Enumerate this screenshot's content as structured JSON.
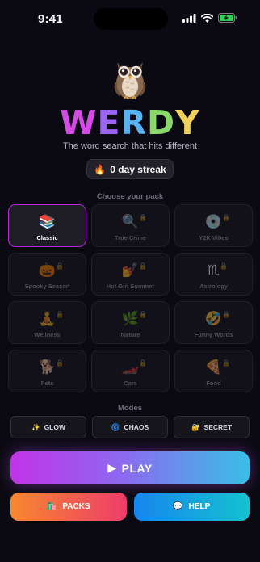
{
  "status_bar": {
    "time": "9:41"
  },
  "app": {
    "title_letters": [
      "W",
      "E",
      "R",
      "D",
      "Y"
    ],
    "title_colors": [
      "#d64be8",
      "#9c64f2",
      "#58b4f0",
      "#8ad86a",
      "#f2d15a"
    ],
    "tagline": "The word search that hits different"
  },
  "streak": {
    "icon": "🔥",
    "label": "0 day streak"
  },
  "packs": {
    "heading": "Choose your pack",
    "items": [
      {
        "emoji": "📚",
        "label": "Classic",
        "locked": false,
        "selected": true
      },
      {
        "emoji": "🔍",
        "label": "True Crime",
        "locked": true
      },
      {
        "emoji": "💿",
        "label": "Y2K Vibes",
        "locked": true
      },
      {
        "emoji": "🎃",
        "label": "Spooky Season",
        "locked": true
      },
      {
        "emoji": "💅",
        "label": "Hot Girl Summer",
        "locked": true
      },
      {
        "emoji": "♏",
        "label": "Astrology",
        "locked": true
      },
      {
        "emoji": "🧘",
        "label": "Wellness",
        "locked": true
      },
      {
        "emoji": "🌿",
        "label": "Nature",
        "locked": true
      },
      {
        "emoji": "🤣",
        "label": "Funny Words",
        "locked": true
      },
      {
        "emoji": "🐕",
        "label": "Pets",
        "locked": true
      },
      {
        "emoji": "🏎️",
        "label": "Cars",
        "locked": true
      },
      {
        "emoji": "🍕",
        "label": "Food",
        "locked": true
      }
    ]
  },
  "modes": {
    "heading": "Modes",
    "items": [
      {
        "icon": "✨",
        "label": "GLOW"
      },
      {
        "icon": "🌀",
        "label": "CHAOS"
      },
      {
        "icon": "🔐",
        "label": "SECRET"
      }
    ]
  },
  "actions": {
    "play": {
      "icon": "▶",
      "label": "PLAY"
    },
    "packs": {
      "icon": "🛍️",
      "label": "PACKS"
    },
    "help": {
      "icon": "💬",
      "label": "HELP"
    }
  }
}
